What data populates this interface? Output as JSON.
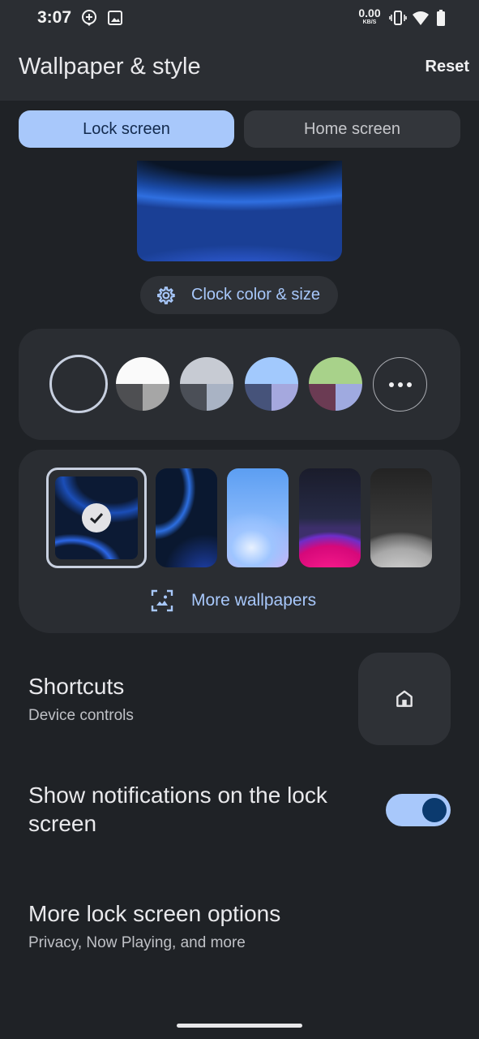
{
  "status_bar": {
    "time": "3:07",
    "net_speed_value": "0.00",
    "net_speed_unit": "KB/S",
    "icons": [
      "location-pin-icon",
      "image-icon",
      "vibrate-icon",
      "wifi-icon",
      "battery-icon"
    ]
  },
  "app_bar": {
    "title": "Wallpaper & style",
    "reset_label": "Reset"
  },
  "tabs": {
    "lock_label": "Lock screen",
    "home_label": "Home screen",
    "selected": "Lock screen"
  },
  "clock_chip": {
    "label": "Clock color & size",
    "icon": "gear-icon"
  },
  "color_options": {
    "swatches": [
      {
        "top": "#a8c8fb",
        "bottom_left": "#4a5263",
        "bottom_right": "#c7a4cf",
        "selected": true
      },
      {
        "top": "#fafafa",
        "bottom_left": "#4e4f52",
        "bottom_right": "#a6a6a6",
        "selected": false
      },
      {
        "top": "#c7cbd3",
        "bottom_left": "#4b4f57",
        "bottom_right": "#a9b3c4",
        "selected": false
      },
      {
        "top": "#a2c9fd",
        "bottom_left": "#46537a",
        "bottom_right": "#a5a8de",
        "selected": false
      },
      {
        "top": "#a8d28a",
        "bottom_left": "#6b3b53",
        "bottom_right": "#9faae0",
        "selected": false
      }
    ],
    "more_icon": "more-horizontal-icon"
  },
  "wallpapers": {
    "more_label": "More wallpapers",
    "more_icon": "wallpaper-image-icon",
    "selected_index": 0
  },
  "shortcuts": {
    "title": "Shortcuts",
    "subtitle": "Device controls",
    "icon": "home-icon"
  },
  "notifications": {
    "title_line1": "Show notifications on the lock",
    "title_line2": "screen",
    "enabled": true
  },
  "more_options": {
    "title": "More lock screen options",
    "subtitle": "Privacy, Now Playing, and more"
  },
  "colors": {
    "accent": "#a8c8fb",
    "background": "#1f2226",
    "card": "#2a2d32",
    "app_bar": "#2b2e33"
  }
}
